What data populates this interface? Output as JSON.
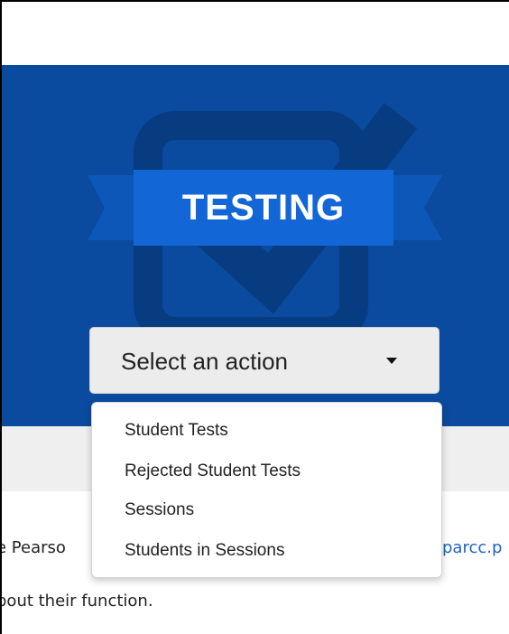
{
  "hero": {
    "title": "TESTING",
    "colors": {
      "background": "#0a4a9f",
      "icon": "#083c80",
      "ribbon": "#1266d6",
      "ribbon_tail": "#0d57b8"
    },
    "icon": "checkbox-check-icon"
  },
  "select": {
    "label": "Select an action",
    "icon": "caret-down-icon",
    "options": [
      {
        "label": "Student Tests"
      },
      {
        "label": "Rejected Student Tests"
      },
      {
        "label": "Sessions"
      },
      {
        "label": "Students in Sessions"
      }
    ]
  },
  "content": {
    "line1": "e Pearso",
    "link": "parcc.p",
    "line2": "bout their function."
  }
}
